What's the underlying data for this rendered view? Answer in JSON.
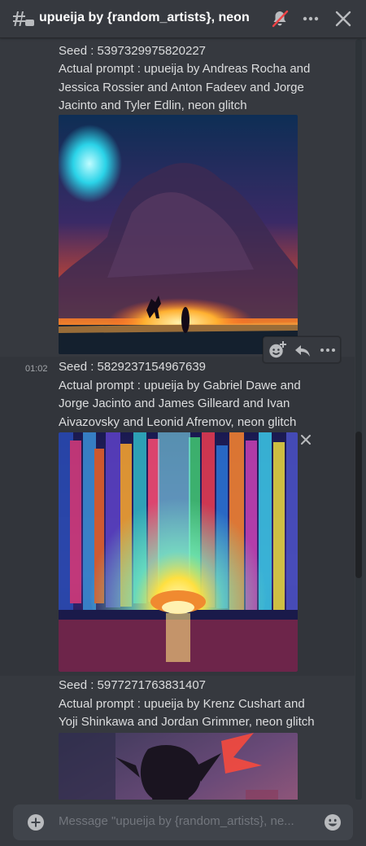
{
  "header": {
    "title": "upueija by {random_artists}, neon",
    "threads_icon": "threads-icon",
    "mute_icon": "bell-slash-icon",
    "more_icon": "more-icon",
    "close_icon": "close-icon"
  },
  "messages": [
    {
      "time": "",
      "seed": "Seed : 5397329975820227",
      "prompt": "Actual prompt : upueija by Andreas Rocha and Jessica Rossier and Anton Fadeev and Jorge Jacinto and Tyler Edlin, neon glitch",
      "image": "neon-landscape-image"
    },
    {
      "time": "01:02",
      "seed": "Seed : 5829237154967639",
      "prompt": "Actual prompt : upueija by Gabriel Dawe and Jorge Jacinto and James Gilleard and Ivan Aivazovsky and Leonid Afremov, neon glitch",
      "image": "prismatic-glitch-image"
    },
    {
      "time": "",
      "seed": "Seed : 5977271763831407",
      "prompt": "Actual prompt : upueija by Krenz Cushart and Yoji Shinkawa and Jordan Grimmer, neon glitch",
      "image": "dark-figure-image"
    }
  ],
  "toolbar": {
    "icons": [
      "add-reaction-icon",
      "reply-icon",
      "more-icon"
    ]
  },
  "composer": {
    "placeholder": "Message \"upueija by {random_artists}, ne..."
  },
  "colors": {
    "background": "#36393f",
    "composer": "#40444b",
    "text": "#dcddde",
    "muted": "#72767d",
    "mute_red": "#ed4245"
  }
}
